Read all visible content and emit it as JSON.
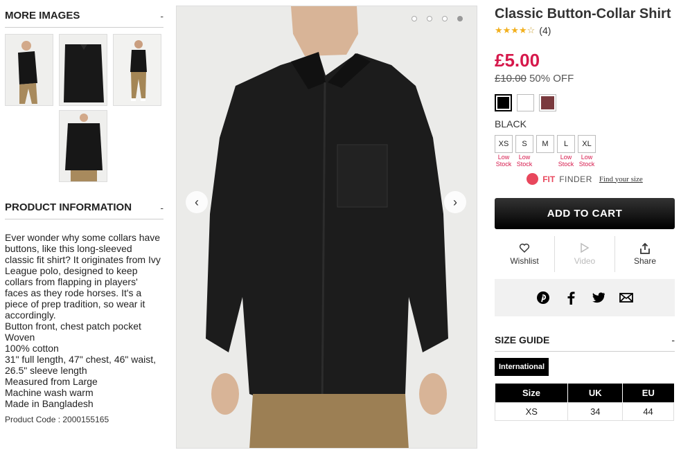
{
  "more_images": {
    "title": "MORE IMAGES",
    "toggle": "-"
  },
  "product_info": {
    "title": "PRODUCT INFORMATION",
    "toggle": "-",
    "description": "Ever wonder why some collars have buttons, like this long-sleeved classic fit shirt? It originates from Ivy League polo, designed to keep collars from flapping in players' faces as they rode horses. It's a piece of prep tradition, so wear it accordingly.",
    "details": [
      "Button front, chest patch pocket",
      "Woven",
      "100% cotton",
      "31\" full length, 47\" chest, 46\" waist, 26.5\" sleeve length",
      "Measured from Large",
      "Machine wash warm",
      "Made in Bangladesh"
    ],
    "product_code": "Product Code : 2000155165"
  },
  "gallery": {
    "prev": "‹",
    "next": "›",
    "active_dot": 4
  },
  "product": {
    "name": "Classic Button-Collar Shirt",
    "rating": 4,
    "review_count": "(4)",
    "price": "£5.00",
    "old_price": "£10.00",
    "discount": "50% OFF",
    "selected_color": "BLACK",
    "colors": [
      "#000000",
      "#ffffff",
      "#7a3a3e"
    ],
    "sizes": [
      {
        "label": "XS",
        "stock": "Low Stock"
      },
      {
        "label": "S",
        "stock": "Low Stock"
      },
      {
        "label": "M",
        "stock": ""
      },
      {
        "label": "L",
        "stock": "Low Stock"
      },
      {
        "label": "XL",
        "stock": "Low Stock"
      }
    ]
  },
  "fit_finder": {
    "fit": "FIT",
    "finder": "FINDER",
    "link": "Find your size"
  },
  "cart": {
    "label": "ADD TO CART"
  },
  "actions": {
    "wishlist": "Wishlist",
    "video": "Video",
    "share": "Share"
  },
  "size_guide": {
    "title": "SIZE GUIDE",
    "toggle": "-",
    "tab": "International",
    "headers": [
      "Size",
      "UK",
      "EU"
    ],
    "rows": [
      [
        "XS",
        "34",
        "44"
      ]
    ]
  },
  "colors": {
    "price_red": "#d6184b",
    "star": "#f2b01e"
  }
}
